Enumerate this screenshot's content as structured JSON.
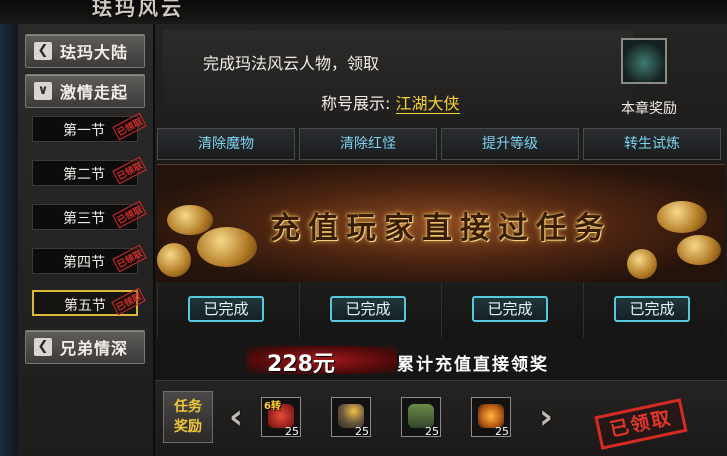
{
  "banner": {
    "title": "珐玛风云"
  },
  "sidebar": {
    "categories": [
      {
        "label": "珐玛大陆",
        "arrow": "chevron-left-icon"
      },
      {
        "label": "激情走起",
        "arrow": "chevron-down-icon"
      },
      {
        "label": "兄弟情深",
        "arrow": "chevron-left-icon"
      }
    ],
    "sections": [
      {
        "label": "第一节",
        "stamp": "已领取"
      },
      {
        "label": "第二节",
        "stamp": "已领取"
      },
      {
        "label": "第三节",
        "stamp": "已领取"
      },
      {
        "label": "第四节",
        "stamp": "已领取"
      },
      {
        "label": "第五节",
        "stamp": "已领取"
      }
    ],
    "active_section": "第五节"
  },
  "main": {
    "task_text": "完成玛法风云人物，领取",
    "title_label": "称号展示:",
    "title_value": "江湖大侠",
    "chapter_reward_label": "本章奖励",
    "tabs": [
      "清除魔物",
      "清除红怪",
      "提升等级",
      "转生试炼"
    ],
    "promo_text": "充值玩家直接过任务",
    "status": [
      "已完成",
      "已完成",
      "已完成",
      "已完成"
    ],
    "amount": "228元",
    "amount_desc": "累计充值直接领奖",
    "rewards_label_line1": "任务",
    "rewards_label_line2": "奖励",
    "items": [
      {
        "icon": "red-gem-icon",
        "qty": "25",
        "tag": "6转"
      },
      {
        "icon": "skull-pouch-icon",
        "qty": "25",
        "tag": ""
      },
      {
        "icon": "green-chest-icon",
        "qty": "25",
        "tag": ""
      },
      {
        "icon": "fire-horn-icon",
        "qty": "25",
        "tag": ""
      }
    ],
    "claimed": "已领取"
  },
  "colors": {
    "accent_cyan": "#58c9dd",
    "gold": "#f3d23a",
    "stamp_red": "#d42c24"
  }
}
